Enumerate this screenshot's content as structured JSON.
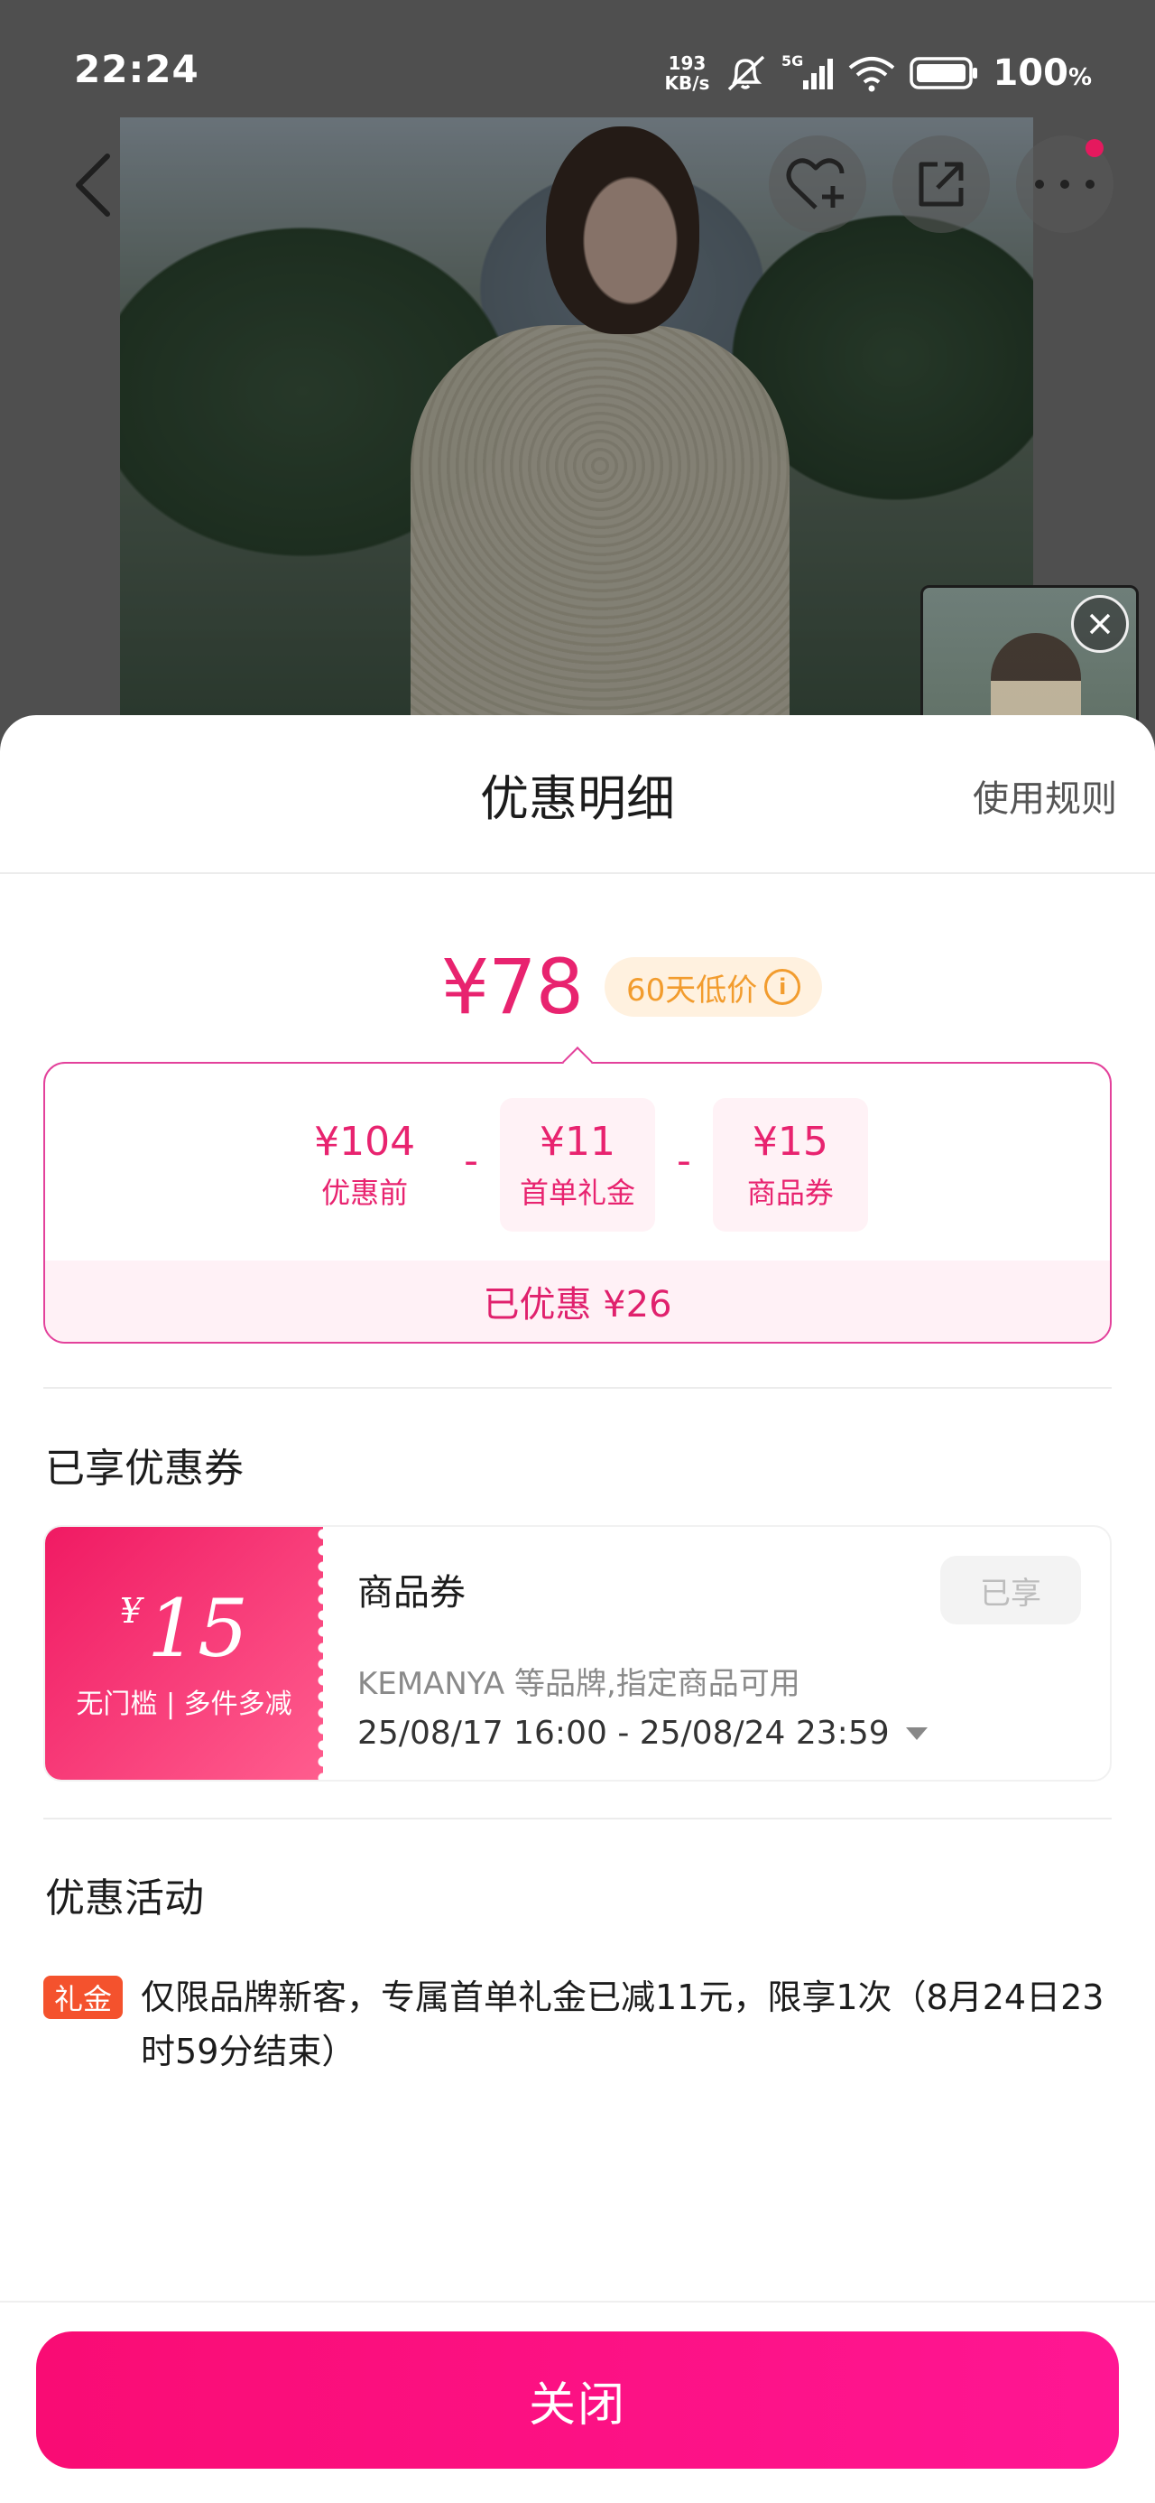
{
  "status_bar": {
    "time": "22:24",
    "net_speed_value": "193",
    "net_speed_unit": "KB/s",
    "network": "5G",
    "battery_value": "100",
    "battery_unit": "%"
  },
  "sheet": {
    "title": "优惠明细",
    "rules_link": "使用规则",
    "final_price": "¥78",
    "low_price_badge": "60天低价",
    "breakdown": {
      "items": [
        {
          "value": "¥104",
          "label": "优惠前"
        },
        {
          "value": "¥11",
          "label": "首单礼金"
        },
        {
          "value": "¥15",
          "label": "商品券"
        }
      ],
      "operator": "-",
      "saved_text": "已优惠 ¥26"
    },
    "coupons_section_title": "已享优惠券",
    "coupon": {
      "currency": "¥",
      "amount": "15",
      "condition": "无门槛 | 多件多减",
      "name": "商品券",
      "status": "已享",
      "description": "KEMANYA 等品牌,指定商品可用",
      "period": "25/08/17 16:00 - 25/08/24 23:59"
    },
    "activities_section_title": "优惠活动",
    "activity": {
      "tag": "礼金",
      "text": "仅限品牌新客，专属首单礼金已减11元，限享1次（8月24日23时59分结束）"
    },
    "close_button": "关闭"
  },
  "colors": {
    "accent": "#e8236f",
    "button_gradient_start": "#f90c74",
    "button_gradient_end": "#ff1693",
    "badge_orange": "#f29c2e",
    "gift_tag": "#f4522d"
  }
}
